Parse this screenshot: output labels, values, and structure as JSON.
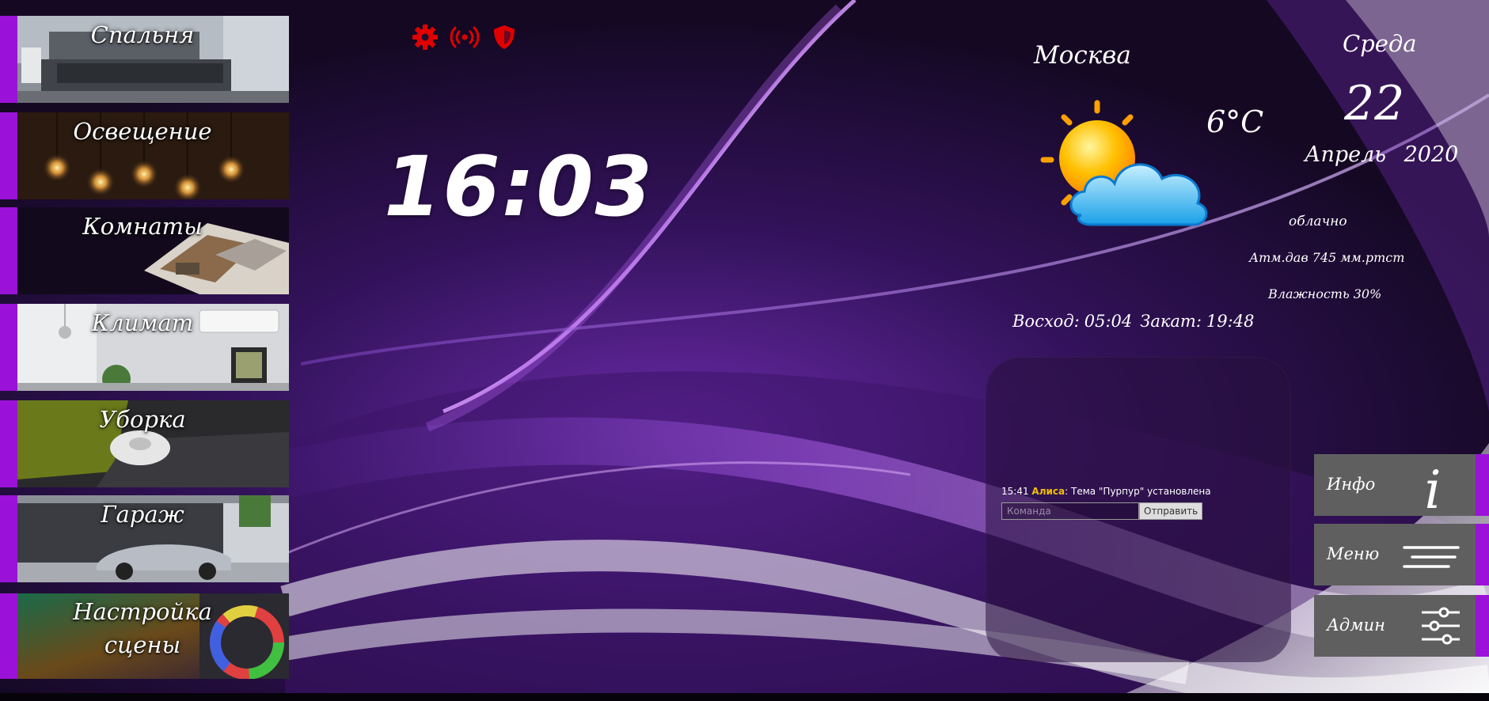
{
  "sidebar": {
    "items": [
      {
        "label": "Спальня"
      },
      {
        "label": "Освещение"
      },
      {
        "label": "Комнаты"
      },
      {
        "label": "Климат"
      },
      {
        "label": "Уборка"
      },
      {
        "label": "Гараж"
      },
      {
        "label": "Настройка\nсцены"
      }
    ]
  },
  "status_icons": [
    "gear-icon",
    "wireless-signal-icon",
    "shield-icon"
  ],
  "status_color": "#e00000",
  "clock": {
    "time": "16:03"
  },
  "weather": {
    "city": "Москва",
    "temperature": "6°C",
    "description": "облачно",
    "pressure_label": "Атм.дав",
    "pressure_value": "745 мм.ртст",
    "humidity_label": "Влажность",
    "humidity_value": "30%",
    "sunrise_label": "Восход:",
    "sunrise": "05:04",
    "sunset_label": "Закат:",
    "sunset": "19:48",
    "icon": "sun-cloud-icon"
  },
  "date": {
    "weekday": "Среда",
    "day": "22",
    "month": "Апрель",
    "year": "2020"
  },
  "chat": {
    "message_time": "15:41",
    "message_sender": "Алиса",
    "message_text": ": Тема \"Пурпур\" установлена",
    "input_placeholder": "Команда",
    "send_label": "Отправить"
  },
  "right_buttons": [
    {
      "label": "Инфо",
      "icon": "info-icon"
    },
    {
      "label": "Меню",
      "icon": "menu-icon"
    },
    {
      "label": "Админ",
      "icon": "sliders-icon"
    }
  ],
  "accent_color": "#9a12d8"
}
